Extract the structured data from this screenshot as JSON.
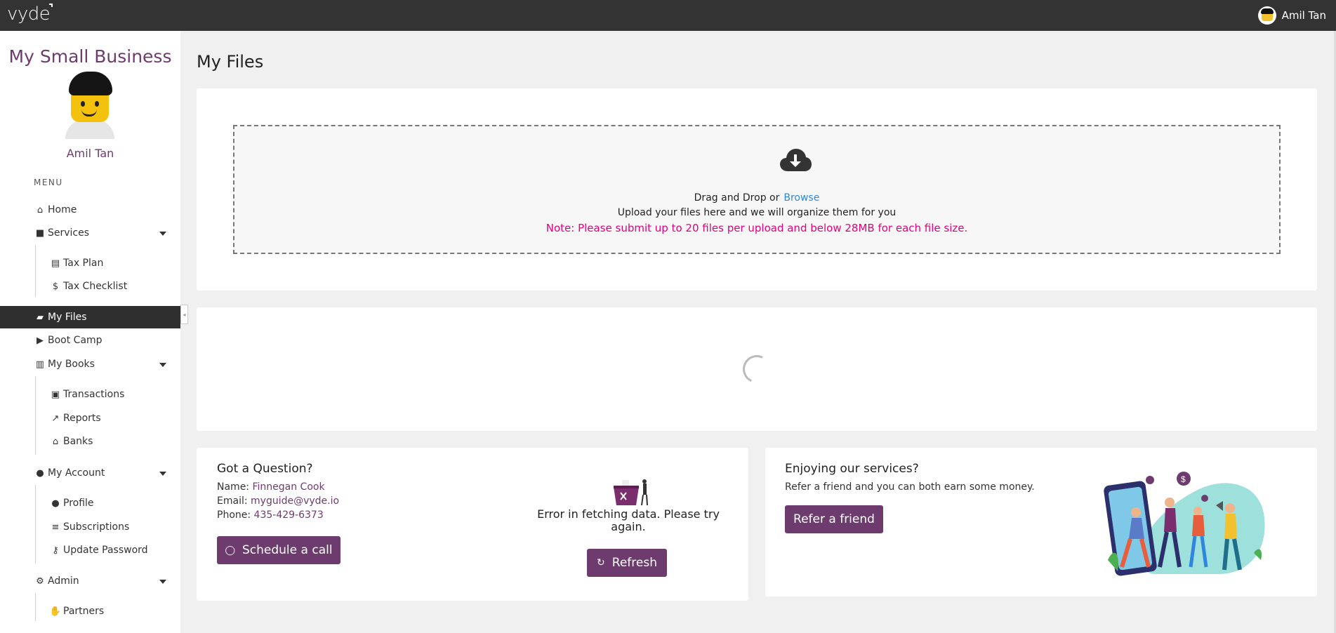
{
  "topbar": {
    "logo": "vyde",
    "user_name": "Amil Tan"
  },
  "sidebar": {
    "business_title": "My Small Business",
    "user_name": "Amil Tan",
    "menu_label": "MENU",
    "items": {
      "home": "Home",
      "services": "Services",
      "tax_plan": "Tax Plan",
      "tax_checklist": "Tax Checklist",
      "my_files": "My Files",
      "boot_camp": "Boot Camp",
      "my_books": "My Books",
      "transactions": "Transactions",
      "reports": "Reports",
      "banks": "Banks",
      "my_account": "My Account",
      "profile": "Profile",
      "subscriptions": "Subscriptions",
      "update_password": "Update Password",
      "admin": "Admin",
      "partners": "Partners"
    }
  },
  "main": {
    "page_title": "My Files",
    "upload": {
      "drag_text": "Drag and Drop or",
      "browse_link": "Browse",
      "sub_text": "Upload your files here and we will organize them for you",
      "note": "Note: Please submit up to 20 files per upload and below 28MB for each file size."
    },
    "question": {
      "title": "Got a Question?",
      "name_label": "Name:",
      "name_value": "Finnegan Cook",
      "email_label": "Email:",
      "email_value": "myguide@vyde.io",
      "phone_label": "Phone:",
      "phone_value": "435-429-6373",
      "schedule_button": "Schedule a call",
      "error_text": "Error in fetching data. Please try again.",
      "refresh_button": "Refresh"
    },
    "refer": {
      "title": "Enjoying our services?",
      "text": "Refer a friend and you can both earn some money.",
      "button": "Refer a friend"
    }
  },
  "colors": {
    "brand_purple": "#6e3b6e",
    "topbar": "#333333",
    "note_pink": "#e6007e",
    "link_blue": "#2e86de"
  }
}
